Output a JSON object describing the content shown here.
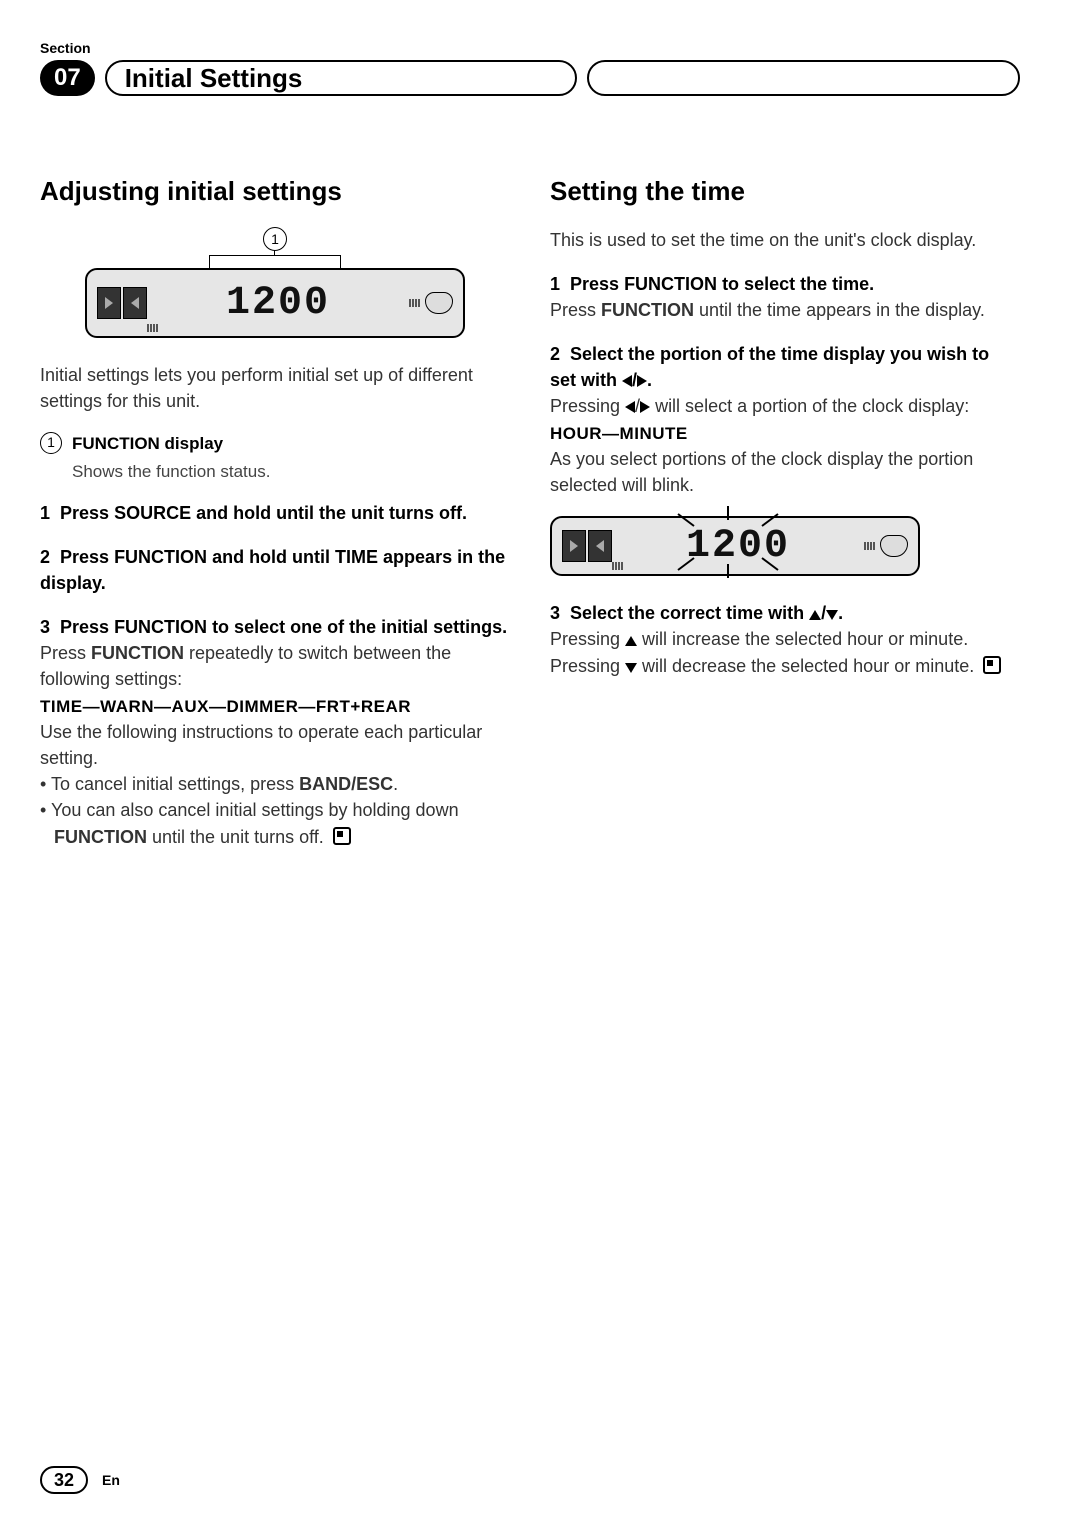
{
  "header": {
    "section_label": "Section",
    "section_number": "07",
    "title": "Initial Settings"
  },
  "left": {
    "heading": "Adjusting initial settings",
    "figure": {
      "callout_number": "1",
      "lcd_value": "1200"
    },
    "intro": "Initial settings lets you perform initial set up of different settings for this unit.",
    "callout": {
      "number": "1",
      "title": "FUNCTION display",
      "body": "Shows the function status."
    },
    "step1": {
      "num": "1",
      "pre": "Press ",
      "btn": "SOURCE",
      "post": " and hold until the unit turns off."
    },
    "step2": {
      "num": "2",
      "pre": "Press ",
      "btn1": "FUNCTION",
      "mid": " and hold until ",
      "btn2": "TIME",
      "post": " appears in the display."
    },
    "step3": {
      "num": "3",
      "pre": "Press ",
      "btn": "FUNCTION",
      "post": " to select one of the initial settings.",
      "body_pre": "Press ",
      "body_btn": "FUNCTION",
      "body_post": " repeatedly to switch between the following settings:",
      "chain": "TIME—WARN—AUX—DIMMER—FRT+REAR",
      "instr": "Use the following instructions to operate each particular setting.",
      "bullet1_pre": "• To cancel initial settings, press ",
      "bullet1_btn": "BAND/ESC",
      "bullet1_post": ".",
      "bullet2_pre": "• You can also cancel initial settings by holding down ",
      "bullet2_btn": "FUNCTION",
      "bullet2_post": " until the unit turns off."
    }
  },
  "right": {
    "heading": "Setting the time",
    "intro": "This is used to set the time on the unit's clock display.",
    "step1": {
      "num": "1",
      "head_pre": "Press ",
      "head_btn": "FUNCTION",
      "head_post": " to select the time.",
      "body_pre": "Press ",
      "body_btn": "FUNCTION",
      "body_post": " until the time appears in the display."
    },
    "step2": {
      "num": "2",
      "head_pre": "Select the portion of the time display you wish to set with ",
      "head_post": ".",
      "body_pre": "Pressing ",
      "body_post": " will select a portion of the clock display:",
      "chain": "HOUR—MINUTE",
      "tail": "As you select portions of the clock display the portion selected will blink."
    },
    "figure": {
      "lcd_left": "12",
      "lcd_right": "00"
    },
    "step3": {
      "num": "3",
      "head_pre": "Select the correct time with ",
      "head_post": ".",
      "body1_pre": "Pressing ",
      "body1_post": " will increase the selected hour or minute. Pressing ",
      "body2_post": " will decrease the selected hour or minute."
    }
  },
  "footer": {
    "page": "32",
    "lang": "En"
  }
}
